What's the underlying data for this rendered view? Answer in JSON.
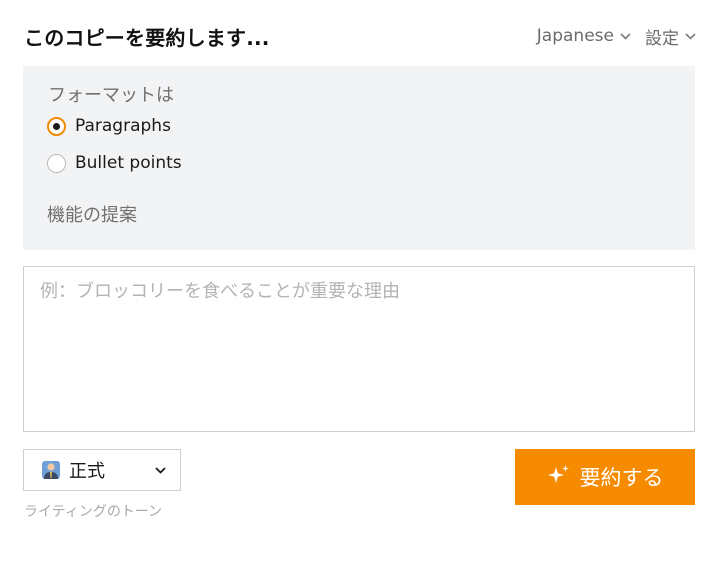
{
  "header": {
    "title": "このコピーを要約します...",
    "language_label": "Japanese",
    "settings_label": "設定"
  },
  "format": {
    "label": "フォーマットは",
    "options": [
      {
        "label": "Paragraphs",
        "selected": true
      },
      {
        "label": "Bullet points",
        "selected": false
      }
    ],
    "suggest_label": "機能の提案"
  },
  "input": {
    "placeholder": "例：ブロッコリーを食べることが重要な理由",
    "value": ""
  },
  "tone": {
    "icon": "business-person-emoji",
    "selected": "正式",
    "caption": "ライティングのトーン"
  },
  "actions": {
    "summarize_label": "要約する",
    "summarize_icon": "sparkles-icon"
  },
  "colors": {
    "accent": "#f78b00",
    "panel_bg": "#f2f3f5",
    "muted_text": "#707070"
  }
}
